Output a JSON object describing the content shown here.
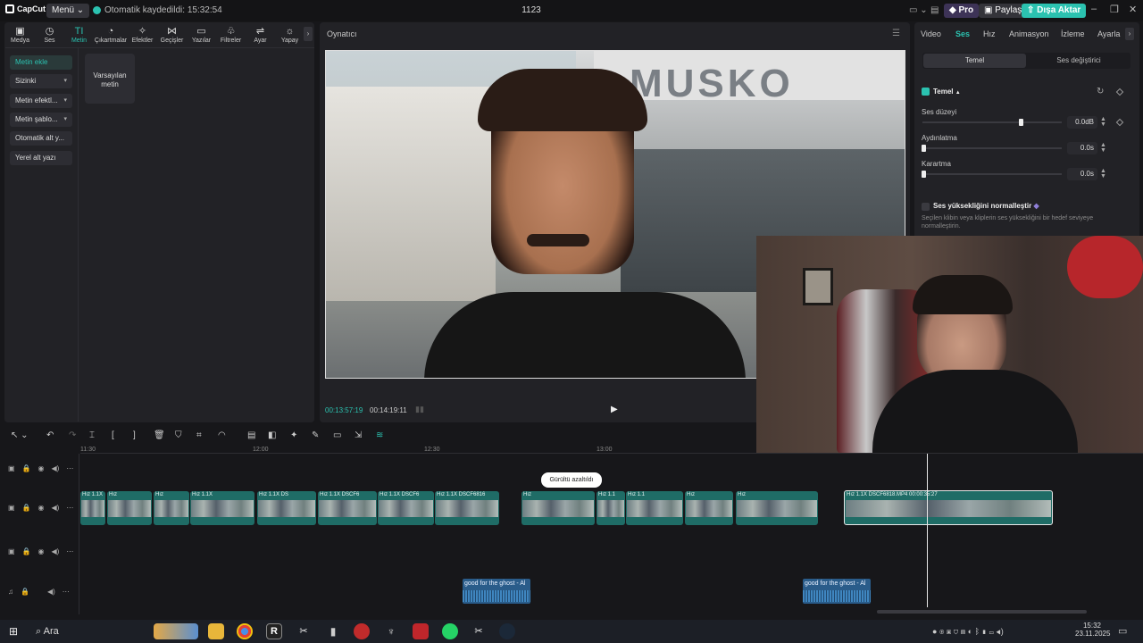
{
  "app": {
    "logo": "CapCut",
    "menu": "Menü",
    "saved_status": "Otomatik kaydedildi: 15:32:54",
    "project_title": "1123",
    "pro": "Pro",
    "share": "Paylaş",
    "export": "Dışa Aktar"
  },
  "tabs": [
    {
      "label": "Medya",
      "icon": "media-icon"
    },
    {
      "label": "Ses",
      "icon": "audio-icon"
    },
    {
      "label": "Metin",
      "icon": "text-icon"
    },
    {
      "label": "Çıkartmalar",
      "icon": "sticker-icon"
    },
    {
      "label": "Efektler",
      "icon": "effects-icon"
    },
    {
      "label": "Geçişler",
      "icon": "transition-icon"
    },
    {
      "label": "Yazılar",
      "icon": "captions-icon"
    },
    {
      "label": "Filtreler",
      "icon": "filter-icon"
    },
    {
      "label": "Ayar",
      "icon": "adjust-icon"
    },
    {
      "label": "Yapay",
      "icon": "ai-icon"
    }
  ],
  "sidebar": {
    "items": [
      {
        "label": "Metin ekle"
      },
      {
        "label": "Sizinki"
      },
      {
        "label": "Metin efektl..."
      },
      {
        "label": "Metin şablo..."
      },
      {
        "label": "Otomatik alt y..."
      },
      {
        "label": "Yerel alt yazı"
      }
    ],
    "card": "Varsayılan metin"
  },
  "player": {
    "title": "Oynatıcı",
    "current_time": "00:13:57:19",
    "total_time": "00:14:19:11",
    "sign_text": "MUSKO"
  },
  "props": {
    "tabs": [
      "Video",
      "Ses",
      "Hız",
      "Animasyon",
      "İzleme",
      "Ayarla"
    ],
    "segment": [
      "Temel",
      "Ses değiştirici"
    ],
    "section": "Temel",
    "volume_label": "Ses düzeyi",
    "volume_value": "0.0dB",
    "fadein_label": "Aydınlatma",
    "fadein_value": "0.0s",
    "fadeout_label": "Karartma",
    "fadeout_value": "0.0s",
    "normalize_label": "Ses yüksekliğini normalleştir",
    "normalize_desc_1": "Seçilen klibin veya kliplerin ses yüksekliğini bir hedef seviyeye",
    "normalize_desc_2": "normalleştirin."
  },
  "timeline": {
    "ruler": [
      "11:30",
      "12:00",
      "12:30",
      "13:00"
    ],
    "toast": "Gürültü azaltıldı",
    "clip_labels": [
      "Hız 1.1X",
      "Hız",
      "Hız 1.1X",
      "Hız 1.1X DS",
      "Hız 1.1X DSCF6",
      "Hız 1.1X DSCF6",
      "Hız 1.1X DSCF6816",
      "Hız",
      "Hız 1.1",
      "Hız 1.1",
      "Hız",
      "Hız 1.1X  DSCF6818.MP4  00:00:35:27"
    ],
    "audio_clips": [
      "good for the ghost - Al",
      "good for the ghost - Al"
    ]
  },
  "taskbar": {
    "search": "Ara",
    "time": "15:32",
    "date": "23.11.2025"
  }
}
